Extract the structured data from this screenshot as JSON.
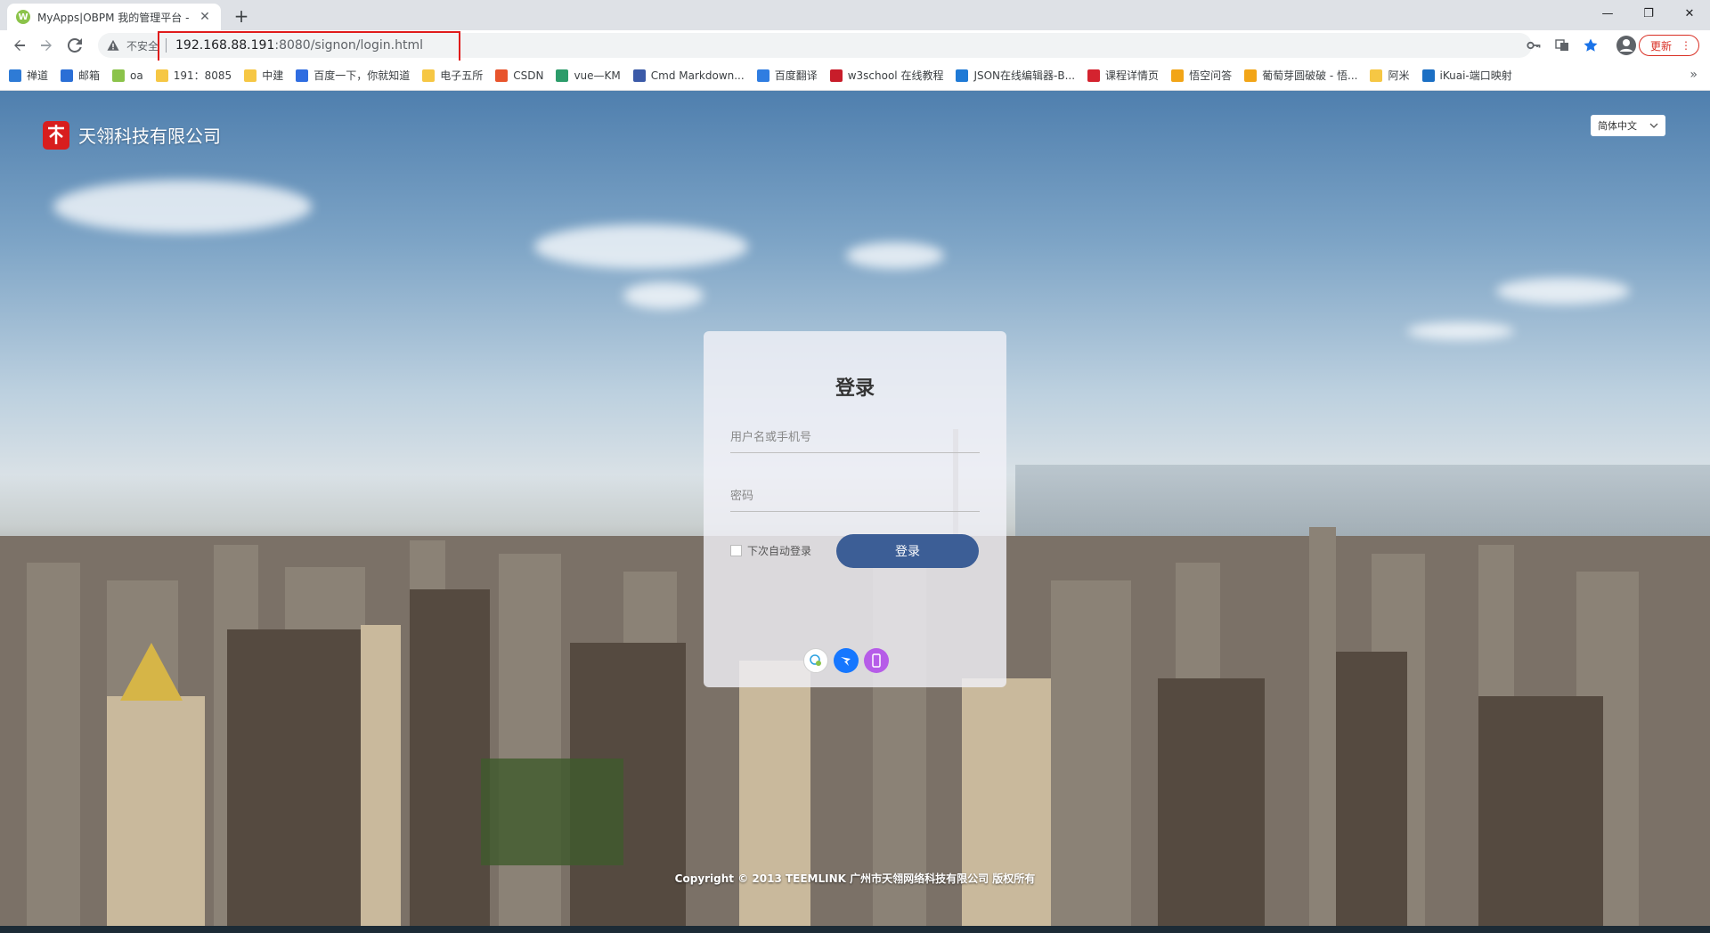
{
  "browser": {
    "tab": {
      "favicon": "W",
      "title": "MyApps|OBPM 我的管理平台 -"
    },
    "new_tab": "+",
    "window_controls": {
      "minimize": "—",
      "restore": "❐",
      "close": "✕"
    },
    "omnibox": {
      "security_label": "不安全",
      "url_host": "192.168.88.191",
      "url_rest": ":8080/signon/login.html"
    },
    "update_label": "更新",
    "menu_glyph": "⋮",
    "bookmarks": [
      {
        "label": "禅道",
        "icon": "zentao-icon",
        "color": "#2e7bd6"
      },
      {
        "label": "邮箱",
        "icon": "mail-icon",
        "color": "#2b6fd6"
      },
      {
        "label": "oa",
        "icon": "oa-icon",
        "color": "#8bc34a"
      },
      {
        "label": "191：8085",
        "icon": "folder-icon",
        "color": "#f6c744"
      },
      {
        "label": "中建",
        "icon": "folder-icon",
        "color": "#f6c744"
      },
      {
        "label": "百度一下，你就知道",
        "icon": "baidu-icon",
        "color": "#2f6de1"
      },
      {
        "label": "电子五所",
        "icon": "folder-icon",
        "color": "#f6c744"
      },
      {
        "label": "CSDN",
        "icon": "csdn-icon",
        "color": "#e8542c"
      },
      {
        "label": "vue—KM",
        "icon": "vue-icon",
        "color": "#2c9c6a"
      },
      {
        "label": "Cmd Markdown...",
        "icon": "cmd-markdown-icon",
        "color": "#3b5aa8"
      },
      {
        "label": "百度翻译",
        "icon": "translate-icon",
        "color": "#2f7de1"
      },
      {
        "label": "w3school 在线教程",
        "icon": "w3school-icon",
        "color": "#c81d2a"
      },
      {
        "label": "JSON在线编辑器-B...",
        "icon": "json-editor-icon",
        "color": "#1f7ad6"
      },
      {
        "label": "课程详情页",
        "icon": "course-icon",
        "color": "#d4232f"
      },
      {
        "label": "悟空问答",
        "icon": "wukong-icon",
        "color": "#f2a517"
      },
      {
        "label": "葡萄芽圆破破 - 悟...",
        "icon": "wukong-icon",
        "color": "#f2a517"
      },
      {
        "label": "阿米",
        "icon": "folder-icon",
        "color": "#f6c744"
      },
      {
        "label": "iKuai-端口映射",
        "icon": "ikuai-icon",
        "color": "#1b6fc4"
      }
    ],
    "bookmarks_more": "»"
  },
  "page": {
    "brand_name": "天翎科技有限公司",
    "language": "简体中文",
    "login": {
      "title": "登录",
      "username_placeholder": "用户名或手机号",
      "password_placeholder": "密码",
      "remember_label": "下次自动登录",
      "submit_label": "登录",
      "social": [
        {
          "icon": "qrcode-chat-icon",
          "color": "#ffffff"
        },
        {
          "icon": "dingtalk-icon",
          "color": "#1677ff"
        },
        {
          "icon": "mobile-icon",
          "color": "#b65ce8"
        }
      ]
    },
    "copyright": "Copyright © 2013 TEEMLINK 广州市天翎网络科技有限公司 版权所有"
  }
}
